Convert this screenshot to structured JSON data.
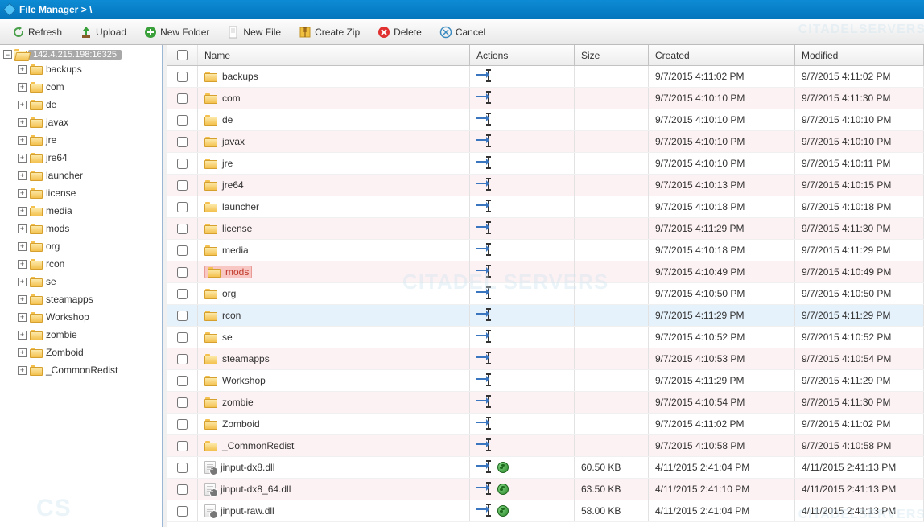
{
  "titlebar": {
    "title": "File Manager > \\"
  },
  "toolbar": {
    "refresh": "Refresh",
    "upload": "Upload",
    "new_folder": "New Folder",
    "new_file": "New File",
    "create_zip": "Create Zip",
    "delete": "Delete",
    "cancel": "Cancel"
  },
  "tree": {
    "server": "142.4.215.198:16325",
    "items": [
      "backups",
      "com",
      "de",
      "javax",
      "jre",
      "jre64",
      "launcher",
      "license",
      "media",
      "mods",
      "org",
      "rcon",
      "se",
      "steamapps",
      "Workshop",
      "zombie",
      "Zomboid",
      "_CommonRedist"
    ]
  },
  "columns": {
    "name": "Name",
    "actions": "Actions",
    "size": "Size",
    "created": "Created",
    "modified": "Modified"
  },
  "rows": [
    {
      "type": "folder",
      "name": "backups",
      "size": "",
      "created": "9/7/2015 4:11:02 PM",
      "modified": "9/7/2015 4:11:02 PM",
      "highlight": "none"
    },
    {
      "type": "folder",
      "name": "com",
      "size": "",
      "created": "9/7/2015 4:10:10 PM",
      "modified": "9/7/2015 4:11:30 PM",
      "highlight": "alt"
    },
    {
      "type": "folder",
      "name": "de",
      "size": "",
      "created": "9/7/2015 4:10:10 PM",
      "modified": "9/7/2015 4:10:10 PM",
      "highlight": "none"
    },
    {
      "type": "folder",
      "name": "javax",
      "size": "",
      "created": "9/7/2015 4:10:10 PM",
      "modified": "9/7/2015 4:10:10 PM",
      "highlight": "alt"
    },
    {
      "type": "folder",
      "name": "jre",
      "size": "",
      "created": "9/7/2015 4:10:10 PM",
      "modified": "9/7/2015 4:10:11 PM",
      "highlight": "none"
    },
    {
      "type": "folder",
      "name": "jre64",
      "size": "",
      "created": "9/7/2015 4:10:13 PM",
      "modified": "9/7/2015 4:10:15 PM",
      "highlight": "alt"
    },
    {
      "type": "folder",
      "name": "launcher",
      "size": "",
      "created": "9/7/2015 4:10:18 PM",
      "modified": "9/7/2015 4:10:18 PM",
      "highlight": "none"
    },
    {
      "type": "folder",
      "name": "license",
      "size": "",
      "created": "9/7/2015 4:11:29 PM",
      "modified": "9/7/2015 4:11:30 PM",
      "highlight": "alt"
    },
    {
      "type": "folder",
      "name": "media",
      "size": "",
      "created": "9/7/2015 4:10:18 PM",
      "modified": "9/7/2015 4:11:29 PM",
      "highlight": "none"
    },
    {
      "type": "folder",
      "name": "mods",
      "size": "",
      "created": "9/7/2015 4:10:49 PM",
      "modified": "9/7/2015 4:10:49 PM",
      "highlight": "pink"
    },
    {
      "type": "folder",
      "name": "org",
      "size": "",
      "created": "9/7/2015 4:10:50 PM",
      "modified": "9/7/2015 4:10:50 PM",
      "highlight": "none"
    },
    {
      "type": "folder",
      "name": "rcon",
      "size": "",
      "created": "9/7/2015 4:11:29 PM",
      "modified": "9/7/2015 4:11:29 PM",
      "highlight": "blue"
    },
    {
      "type": "folder",
      "name": "se",
      "size": "",
      "created": "9/7/2015 4:10:52 PM",
      "modified": "9/7/2015 4:10:52 PM",
      "highlight": "none"
    },
    {
      "type": "folder",
      "name": "steamapps",
      "size": "",
      "created": "9/7/2015 4:10:53 PM",
      "modified": "9/7/2015 4:10:54 PM",
      "highlight": "alt"
    },
    {
      "type": "folder",
      "name": "Workshop",
      "size": "",
      "created": "9/7/2015 4:11:29 PM",
      "modified": "9/7/2015 4:11:29 PM",
      "highlight": "none"
    },
    {
      "type": "folder",
      "name": "zombie",
      "size": "",
      "created": "9/7/2015 4:10:54 PM",
      "modified": "9/7/2015 4:11:30 PM",
      "highlight": "alt"
    },
    {
      "type": "folder",
      "name": "Zomboid",
      "size": "",
      "created": "9/7/2015 4:11:02 PM",
      "modified": "9/7/2015 4:11:02 PM",
      "highlight": "none"
    },
    {
      "type": "folder",
      "name": "_CommonRedist",
      "size": "",
      "created": "9/7/2015 4:10:58 PM",
      "modified": "9/7/2015 4:10:58 PM",
      "highlight": "alt"
    },
    {
      "type": "file",
      "name": "jinput-dx8.dll",
      "size": "60.50 KB",
      "created": "4/11/2015 2:41:04 PM",
      "modified": "4/11/2015 2:41:13 PM",
      "highlight": "none"
    },
    {
      "type": "file",
      "name": "jinput-dx8_64.dll",
      "size": "63.50 KB",
      "created": "4/11/2015 2:41:10 PM",
      "modified": "4/11/2015 2:41:13 PM",
      "highlight": "alt"
    },
    {
      "type": "file",
      "name": "jinput-raw.dll",
      "size": "58.00 KB",
      "created": "4/11/2015 2:41:04 PM",
      "modified": "4/11/2015 2:41:13 PM",
      "highlight": "none"
    }
  ],
  "watermarks": {
    "center": "CITADEL SERVERS",
    "top_right": "CITADELSERVERS",
    "bottom_left": "CS",
    "bottom_right": "CITADELSERVERS"
  }
}
